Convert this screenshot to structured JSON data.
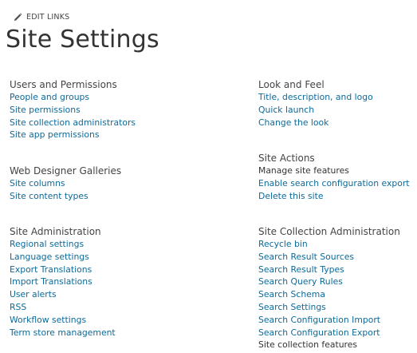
{
  "edit_links": {
    "label": "EDIT LINKS",
    "icon": "pencil-icon"
  },
  "page_title": "Site Settings",
  "colors": {
    "link": "#0b6a9b",
    "heading": "#444444",
    "dark_link": "#333333"
  },
  "left_column": [
    {
      "title": "Users and Permissions",
      "links": [
        "People and groups",
        "Site permissions",
        "Site collection administrators",
        "Site app permissions"
      ]
    },
    {
      "title": "Web Designer Galleries",
      "links": [
        "Site columns",
        "Site content types"
      ]
    },
    {
      "title": "Site Administration",
      "links": [
        "Regional settings",
        "Language settings",
        "Export Translations",
        "Import Translations",
        "User alerts",
        "RSS",
        "Workflow settings",
        "Term store management"
      ]
    }
  ],
  "right_column": [
    {
      "title": "Look and Feel",
      "links": [
        "Title, description, and logo",
        "Quick launch",
        "Change the look"
      ]
    },
    {
      "title": "Site Actions",
      "links": [
        "Manage site features",
        "Enable search configuration export",
        "Delete this site"
      ]
    },
    {
      "title": "Site Collection Administration",
      "links": [
        "Recycle bin",
        "Search Result Sources",
        "Search Result Types",
        "Search Query Rules",
        "Search Schema",
        "Search Settings",
        "Search Configuration Import",
        "Search Configuration Export",
        "Site collection features"
      ]
    }
  ]
}
